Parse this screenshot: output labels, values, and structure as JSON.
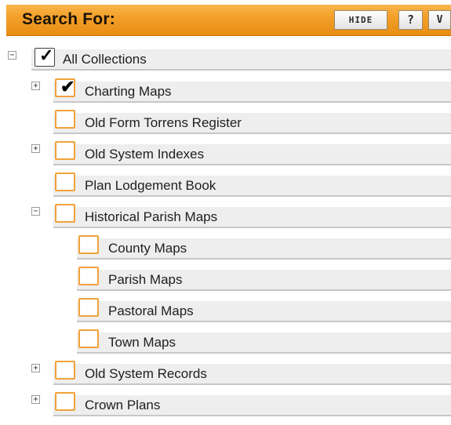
{
  "panel": {
    "title": "Search For:",
    "buttons": {
      "hide": "HIDE",
      "help": "?",
      "more": "V"
    }
  },
  "tree": {
    "items": [
      {
        "label": "All Collections",
        "checked": true,
        "toggle": "−"
      },
      {
        "label": "Charting Maps",
        "checked": true,
        "toggle": "+"
      },
      {
        "label": "Old Form Torrens Register",
        "checked": false,
        "toggle": ""
      },
      {
        "label": "Old System Indexes",
        "checked": false,
        "toggle": "+"
      },
      {
        "label": "Plan Lodgement Book",
        "checked": false,
        "toggle": ""
      },
      {
        "label": "Historical Parish Maps",
        "checked": false,
        "toggle": "−"
      },
      {
        "label": "County Maps",
        "checked": false,
        "toggle": ""
      },
      {
        "label": "Parish Maps",
        "checked": false,
        "toggle": ""
      },
      {
        "label": "Pastoral Maps",
        "checked": false,
        "toggle": ""
      },
      {
        "label": "Town Maps",
        "checked": false,
        "toggle": ""
      },
      {
        "label": "Old System Records",
        "checked": false,
        "toggle": "+"
      },
      {
        "label": "Crown Plans",
        "checked": false,
        "toggle": "+"
      }
    ]
  },
  "colors": {
    "header_top": "#f9b64a",
    "header_bottom": "#e88d12",
    "checkbox_border": "#f1a23a",
    "row_background": "#eeeeee"
  },
  "icons": [
    "collapse-icon",
    "expand-icon",
    "checkmark-icon",
    "help-icon",
    "chevron-down-icon"
  ]
}
